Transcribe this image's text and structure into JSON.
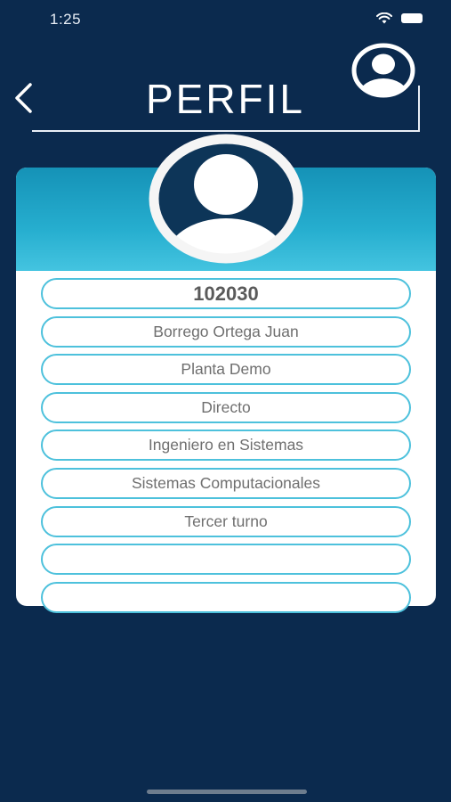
{
  "status_bar": {
    "time": "1:25"
  },
  "header": {
    "title": "PERFIL",
    "back_icon": "chevron-left-icon",
    "account_icon": "user-circle-icon"
  },
  "profile": {
    "avatar_icon": "user-avatar-icon",
    "fields": [
      {
        "value": "102030"
      },
      {
        "value": "Borrego Ortega Juan"
      },
      {
        "value": "Planta Demo"
      },
      {
        "value": "Directo"
      },
      {
        "value": "Ingeniero en Sistemas"
      },
      {
        "value": "Sistemas Computacionales"
      },
      {
        "value": "Tercer turno"
      },
      {
        "value": ""
      },
      {
        "value": ""
      }
    ]
  },
  "colors": {
    "background": "#0b2a4e",
    "accent": "#26aecf",
    "field_border": "#4dc1dc"
  }
}
